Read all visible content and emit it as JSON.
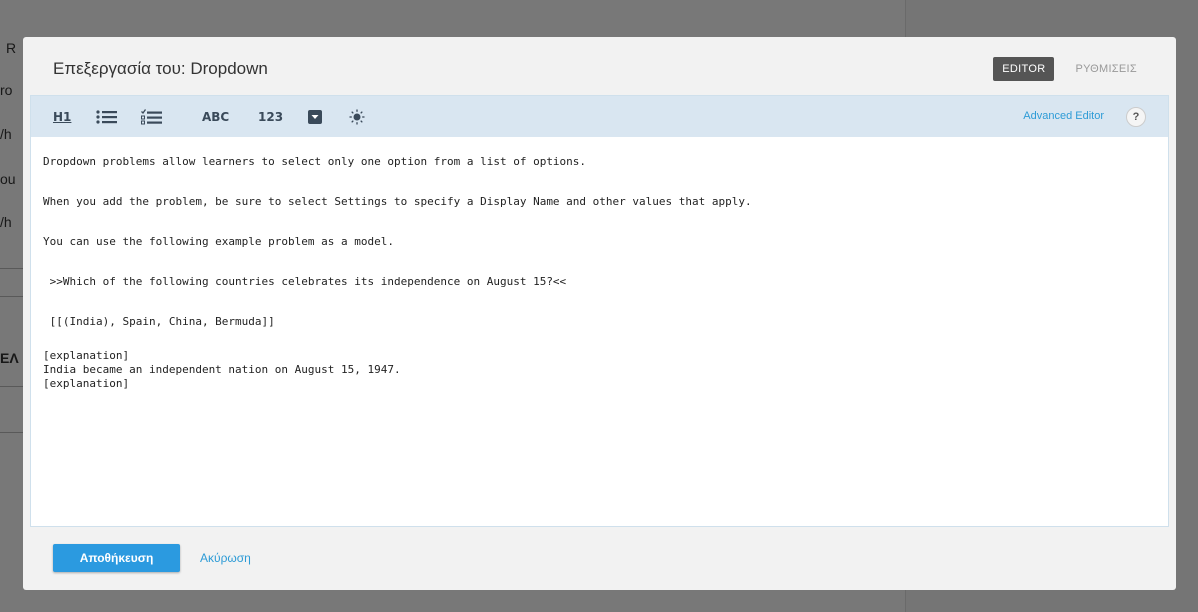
{
  "background": {
    "fragments": [
      "R",
      "ro",
      "/h",
      "ou",
      "/h",
      "ΕΛ"
    ]
  },
  "modal": {
    "title_prefix": "Επεξεργασία του:",
    "title_name": "Dropdown",
    "tabs": {
      "editor": "EDITOR",
      "settings": "ΡΥΘΜΙΣΕΙΣ"
    }
  },
  "toolbar": {
    "h1": "H1",
    "abc": "ABC",
    "num": "123",
    "advanced_editor": "Advanced Editor",
    "help": "?"
  },
  "editor": {
    "lines": [
      "Dropdown problems allow learners to select only one option from a list of options.",
      "When you add the problem, be sure to select Settings to specify a Display Name and other values that apply.",
      "You can use the following example problem as a model.",
      " >>Which of the following countries celebrates its independence on August 15?<<",
      " [[(India), Spain, China, Bermuda]]",
      "[explanation]",
      "India became an independent nation on August 15, 1947.",
      "[explanation]"
    ]
  },
  "footer": {
    "save": "Αποθήκευση",
    "cancel": "Ακύρωση"
  },
  "colors": {
    "accent": "#2b9ae0",
    "toolbar_bg": "#d9e6f1",
    "active_tab": "#555555"
  }
}
